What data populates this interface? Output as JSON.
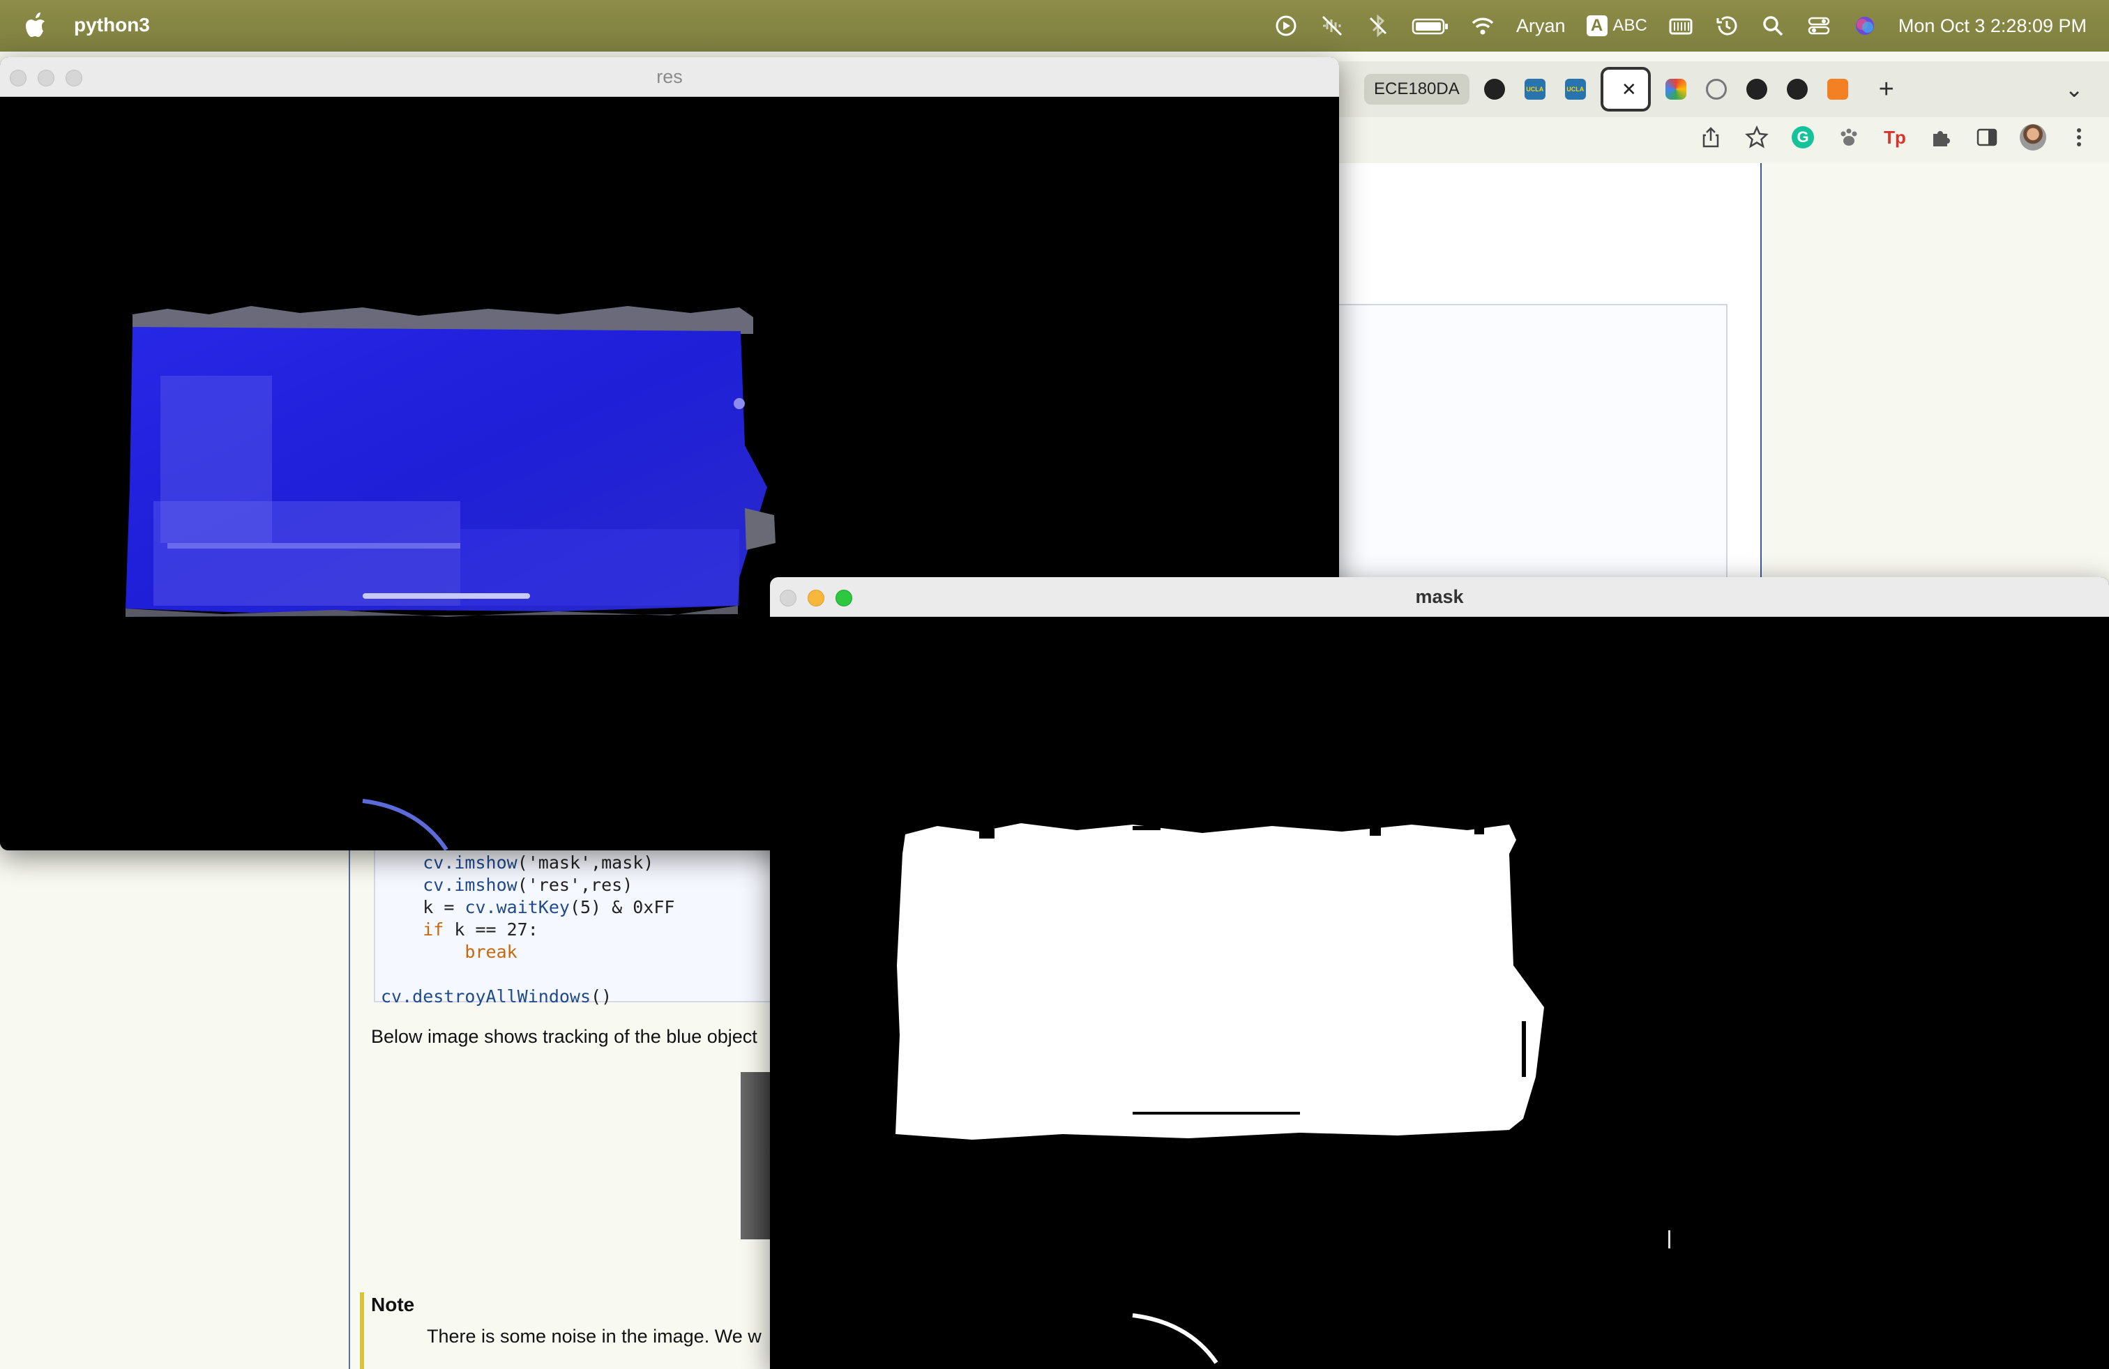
{
  "menubar": {
    "app_name": "python3",
    "user": "Aryan",
    "input_source_letter": "A",
    "input_source": "ABC",
    "clock": "Mon Oct 3  2:28:09 PM",
    "icons": [
      "apple-logo",
      "play-circle-icon",
      "sound-off-icon",
      "bluetooth-icon",
      "battery-icon",
      "wifi-icon",
      "keyboard-icon",
      "time-machine-icon",
      "spotlight-icon",
      "control-center-icon",
      "siri-icon"
    ]
  },
  "browser": {
    "tabs": [
      {
        "label": "ECE180DA",
        "icon": "none"
      },
      {
        "label": "",
        "icon": "github-icon"
      },
      {
        "label": "UCLA",
        "icon": "ucla-icon"
      },
      {
        "label": "UCLA",
        "icon": "ucla-icon"
      },
      {
        "label": "",
        "icon": "active-tab",
        "close": "✕"
      },
      {
        "label": "",
        "icon": "color-app-icon"
      },
      {
        "label": "",
        "icon": "globe-icon"
      },
      {
        "label": "",
        "icon": "github-icon"
      },
      {
        "label": "",
        "icon": "github-icon"
      },
      {
        "label": "",
        "icon": "stackoverflow-icon"
      }
    ],
    "new_tab": "+",
    "tab_overflow": "⌄",
    "toolbar_icons": [
      "share-icon",
      "bookmark-star-icon",
      "grammarly-icon",
      "paw-extension-icon",
      "tp-extension-icon",
      "extensions-puzzle-icon",
      "side-panel-icon",
      "profile-avatar",
      "kebab-menu-icon"
    ],
    "grammarly_letter": "G",
    "tp_label": "Tp"
  },
  "docs": {
    "code_lines": [
      {
        "indent": "    ",
        "fn": "cv.imshow",
        "args": "('mask',mask)"
      },
      {
        "indent": "    ",
        "fn": "cv.imshow",
        "args": "('res',res)"
      },
      {
        "indent": "    ",
        "plain": "k = ",
        "fn": "cv.waitKey",
        "rest": "(5) & 0xFF"
      },
      {
        "indent": "    ",
        "kw": "if",
        "rest": " k == 27:"
      },
      {
        "indent": "        ",
        "kw": "break"
      },
      {
        "blank": ""
      },
      {
        "fn": "cv.destroyAllWindows",
        "rest": "()"
      }
    ],
    "prose": "Below image shows tracking of the blue object",
    "note_title": "Note",
    "note_text": "There is some noise in the image. We w"
  },
  "windows": {
    "res": {
      "title": "res"
    },
    "mask": {
      "title": "mask"
    }
  },
  "colors": {
    "menubar": "#83843f",
    "blue_object": "#1f1fe0",
    "mask_fill": "#ffffff",
    "canvas_bg": "#000000"
  }
}
